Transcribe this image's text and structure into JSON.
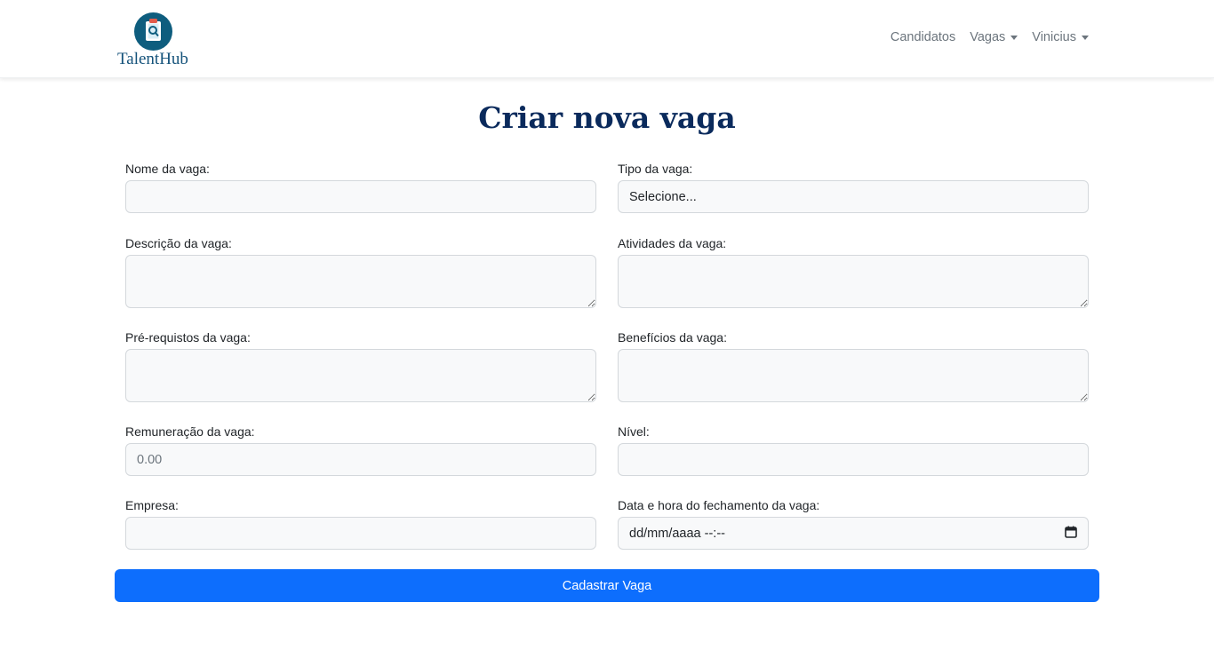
{
  "brand": {
    "name": "TalentHub",
    "logo_icon": "clipboard-search-icon",
    "logo_color": "#0e5d7e"
  },
  "nav": {
    "items": [
      {
        "label": "Candidatos",
        "dropdown": false
      },
      {
        "label": "Vagas",
        "dropdown": true
      },
      {
        "label": "Vinicius",
        "dropdown": true
      }
    ]
  },
  "page": {
    "title": "Criar nova vaga"
  },
  "form": {
    "nome": {
      "label": "Nome da vaga:",
      "value": ""
    },
    "tipo": {
      "label": "Tipo da vaga:",
      "selected": "Selecione..."
    },
    "descricao": {
      "label": "Descrição da vaga:",
      "value": ""
    },
    "atividades": {
      "label": "Atividades da vaga:",
      "value": ""
    },
    "prerequisitos": {
      "label": "Pré-requistos da vaga:",
      "value": ""
    },
    "beneficios": {
      "label": "Benefícios da vaga:",
      "value": ""
    },
    "remuneracao": {
      "label": "Remuneração da vaga:",
      "placeholder": "0.00",
      "value": ""
    },
    "nivel": {
      "label": "Nível:",
      "value": ""
    },
    "empresa": {
      "label": "Empresa:",
      "value": ""
    },
    "fechamento": {
      "label": "Data e hora do fechamento da vaga:",
      "placeholder": "dd/mm/aaaa --:--",
      "icon": "calendar-icon"
    },
    "submit_label": "Cadastrar Vaga"
  },
  "colors": {
    "primary": "#0d6efd",
    "title": "#0a2a5c",
    "input_bg": "#f8f9fa"
  }
}
